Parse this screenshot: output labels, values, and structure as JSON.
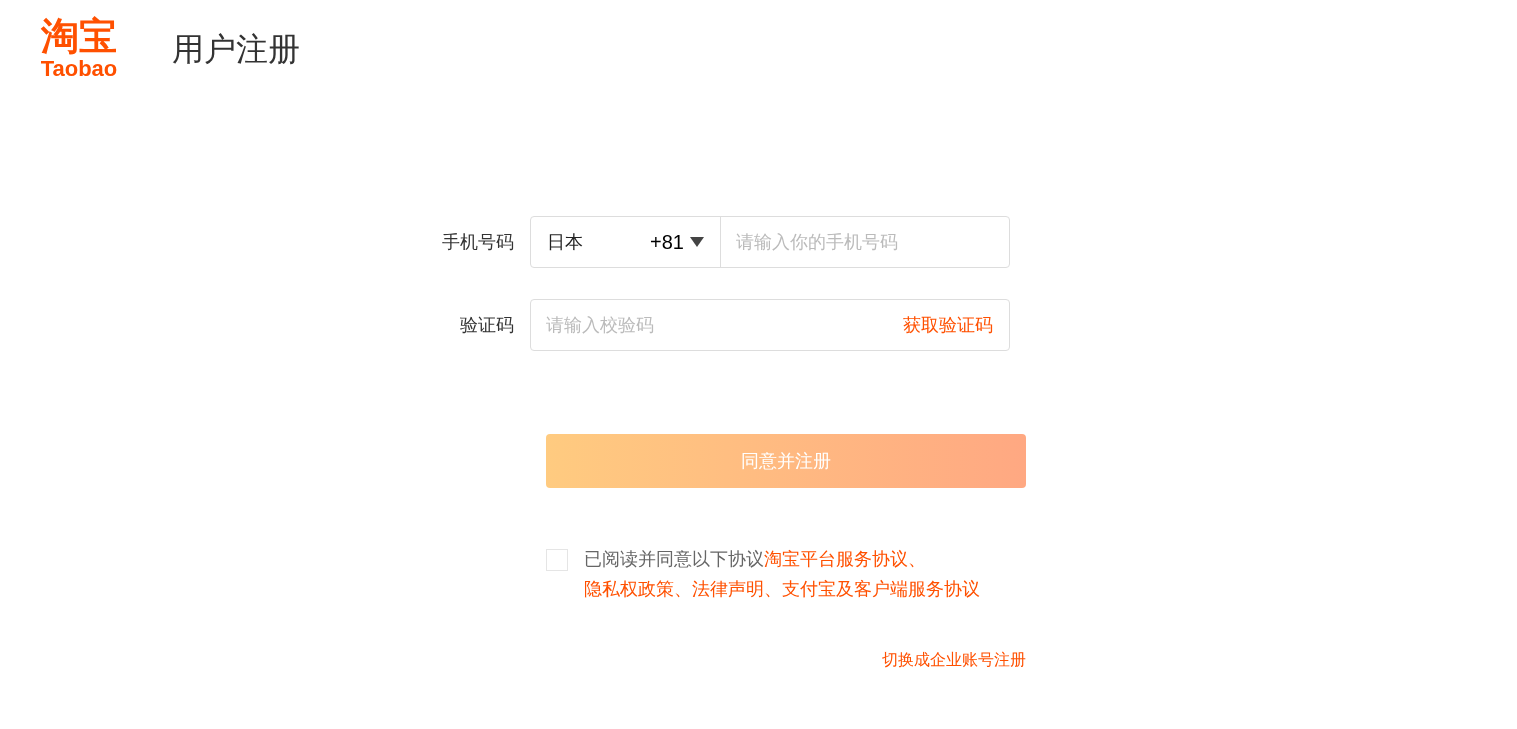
{
  "header": {
    "logo_cn": "淘宝",
    "logo_en": "Taobao",
    "title": "用户注册"
  },
  "form": {
    "phone": {
      "label": "手机号码",
      "country": "日本",
      "code": "+81",
      "placeholder": "请输入你的手机号码"
    },
    "code": {
      "label": "验证码",
      "placeholder": "请输入校验码",
      "action": "获取验证码"
    },
    "submit": {
      "label": "同意并注册",
      "disabled": true
    },
    "agreement": {
      "checked": false,
      "parts": [
        {
          "kind": "text",
          "text": "已阅读并同意以下协议"
        },
        {
          "kind": "link",
          "text": "淘宝平台服务协议"
        },
        {
          "kind": "sep",
          "text": "、"
        },
        {
          "kind": "link",
          "text": "隐私权政策"
        },
        {
          "kind": "sep",
          "text": "、"
        },
        {
          "kind": "link",
          "text": "法律声明"
        },
        {
          "kind": "sep",
          "text": "、"
        },
        {
          "kind": "link",
          "text": "支付宝及客户端服务协议"
        }
      ]
    },
    "switch_link": "切换成企业账号注册"
  }
}
